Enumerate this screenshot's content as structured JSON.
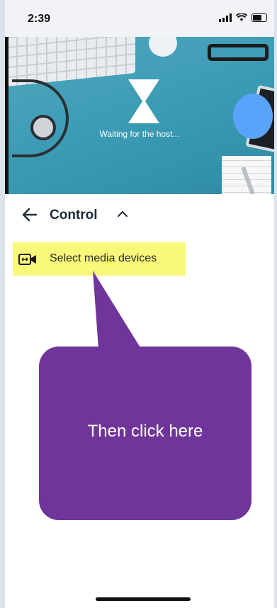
{
  "status_bar": {
    "time": "2:39"
  },
  "video": {
    "waiting_text": "Waiting for the host..."
  },
  "control": {
    "title": "Control"
  },
  "media_devices": {
    "label": "Select media devices"
  },
  "callout": {
    "text": "Then click here",
    "color": "#70359a"
  },
  "colors": {
    "highlight": "#f8f87a",
    "placeholder_blue": "#5aa3fb"
  }
}
